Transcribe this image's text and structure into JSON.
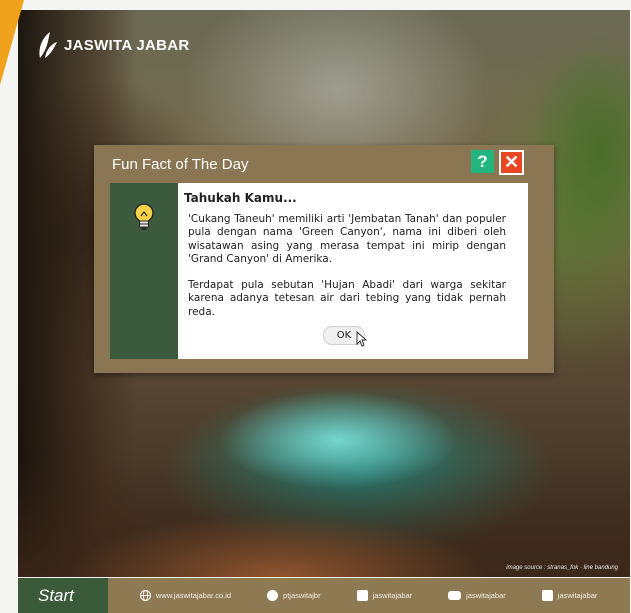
{
  "brand": {
    "name": "JASWITA JABAR"
  },
  "dialog": {
    "title": "Fun Fact of The Day",
    "help_label": "?",
    "close_label": "✕",
    "heading": "Tahukah Kamu...",
    "paragraph1": "'Cukang Taneuh' memiliki arti 'Jembatan Tanah' dan populer pula dengan nama 'Green Canyon', nama ini diberi oleh wisatawan asing yang merasa tempat ini mirip dengan 'Grand Canyon' di Amerika.",
    "paragraph2": "Terdapat pula sebutan 'Hujan Abadi' dari warga sekitar karena adanya tetesan air dari tebing yang tidak pernah reda.",
    "ok_label": "OK"
  },
  "image_credit": "image source : stranas_fok · line bandung",
  "taskbar": {
    "start_label": "Start",
    "links": [
      {
        "icon": "globe-icon",
        "text": "www.jaswitajabar.co.id"
      },
      {
        "icon": "twitter-icon",
        "text": "ptjaswitajbr"
      },
      {
        "icon": "instagram-icon",
        "text": "jaswitajabar"
      },
      {
        "icon": "youtube-icon",
        "text": "jaswitajabar"
      },
      {
        "icon": "facebook-icon",
        "text": "jaswitajabar"
      }
    ]
  },
  "colors": {
    "dialog_bg": "#8a7653",
    "side_panel": "#3c5b3c",
    "help": "#22b57e",
    "close": "#e84724",
    "accent_orange": "#f0a21c",
    "taskbar": "#8d7a52",
    "start": "#3a5a3a"
  }
}
